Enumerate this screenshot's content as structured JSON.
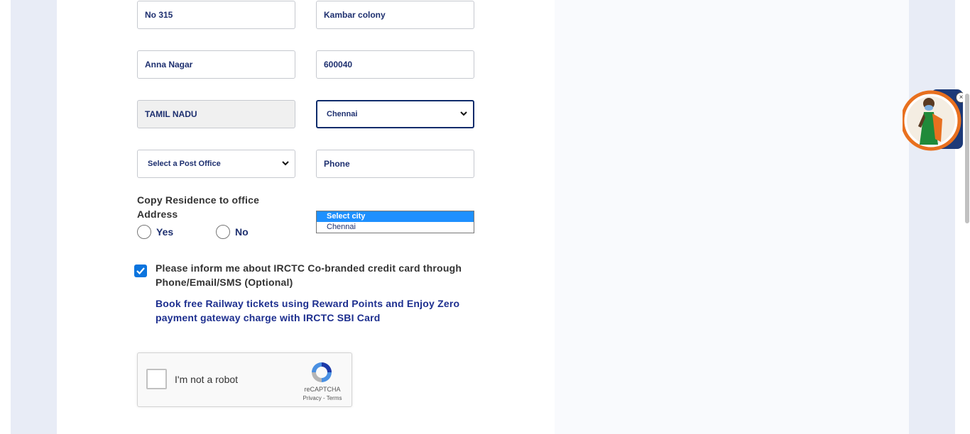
{
  "address": {
    "flat": "No 315",
    "street": "Kambar colony",
    "area": "Anna Nagar",
    "pincode": "600040",
    "state": "TAMIL NADU",
    "city": "Chennai",
    "post_office": "Select a Post Office",
    "phone_placeholder": "Phone"
  },
  "copy_residence": {
    "label": "Copy Residence to office Address",
    "yes": "Yes",
    "no": "No"
  },
  "city_dropdown": {
    "options": [
      "Select city",
      "Chennai"
    ],
    "highlighted": "Select city"
  },
  "consent": {
    "checked": true,
    "text": "Please inform me about IRCTC Co-branded credit card through Phone/Email/SMS (Optional)",
    "promo": "Book free Railway tickets using Reward Points and Enjoy Zero payment gateway charge with IRCTC SBI Card"
  },
  "captcha": {
    "label": "I'm not a robot",
    "brand": "reCAPTCHA",
    "privacy": "Privacy",
    "terms": "Terms",
    "separator": "-"
  },
  "assistant": {
    "close": "×"
  },
  "colors": {
    "accent": "#0b74de",
    "text_navy": "#1d2f6f",
    "side_strip": "#e8ecf6",
    "dropdown_highlight": "#1e90ff"
  }
}
